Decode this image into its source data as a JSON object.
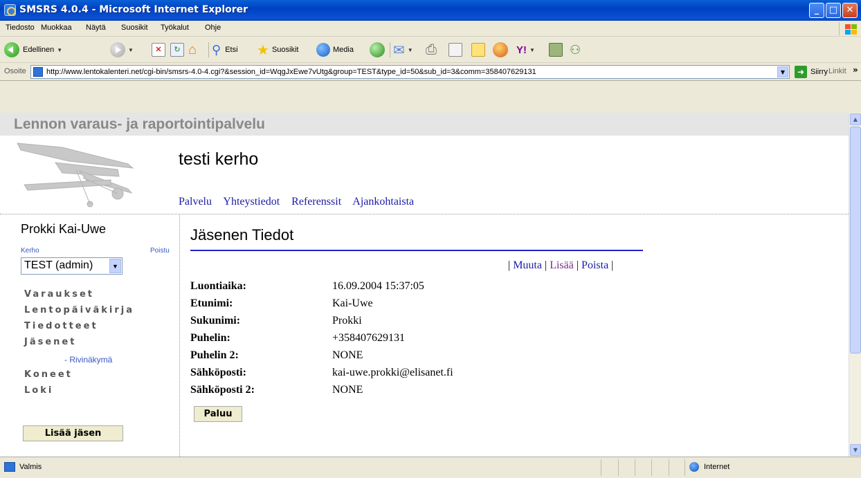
{
  "window": {
    "title": "SMSRS 4.0.4 - Microsoft Internet Explorer",
    "min": "_",
    "max": "□",
    "close": "✕"
  },
  "menu": [
    "Tiedosto",
    "Muokkaa",
    "Näytä",
    "Suosikit",
    "Työkalut",
    "Ohje"
  ],
  "toolbar": {
    "back": "Edellinen",
    "search": "Etsi",
    "favorites": "Suosikit",
    "media": "Media"
  },
  "address": {
    "label": "Osoite",
    "url": "http://www.lentokalenteri.net/cgi-bin/smsrs-4.0-4.cgi?&session_id=WqgJxEwe7vUtg&group=TEST&type_id=50&sub_id=3&comm=358407629131",
    "go": "Siirry",
    "links": "Linkit"
  },
  "page": {
    "service_title": "Lennon varaus- ja raportointipalvelu",
    "club_name": "testi kerho",
    "topnav": [
      "Palvelu",
      "Yhteystiedot",
      "Referenssit",
      "Ajankohtaista"
    ]
  },
  "sidebar": {
    "user": "Prokki Kai-Uwe",
    "club_label": "Kerho",
    "logout": "Poistu",
    "club_select": "TEST (admin)",
    "menu": [
      "Varaukset",
      "Lentopäiväkirja",
      "Tiedotteet",
      "Jäsenet",
      "Koneet",
      "Loki"
    ],
    "sub_item": "- Rivinäkymä",
    "add_button": "Lisää jäsen"
  },
  "main": {
    "title": "Jäsenen Tiedot",
    "actions": {
      "modify": "Muuta",
      "add": "Lisää",
      "delete": "Poista",
      "sep": "|"
    },
    "fields": [
      {
        "label": "Luontiaika:",
        "value": "16.09.2004 15:37:05"
      },
      {
        "label": "Etunimi:",
        "value": "Kai-Uwe"
      },
      {
        "label": "Sukunimi:",
        "value": "Prokki"
      },
      {
        "label": "Puhelin:",
        "value": "+358407629131"
      },
      {
        "label": "Puhelin 2:",
        "value": "NONE"
      },
      {
        "label": "Sähköposti:",
        "value": "kai-uwe.prokki@elisanet.fi"
      },
      {
        "label": "Sähköposti 2:",
        "value": "NONE"
      }
    ],
    "back_button": "Paluu"
  },
  "status": {
    "text": "Valmis",
    "zone": "Internet"
  }
}
